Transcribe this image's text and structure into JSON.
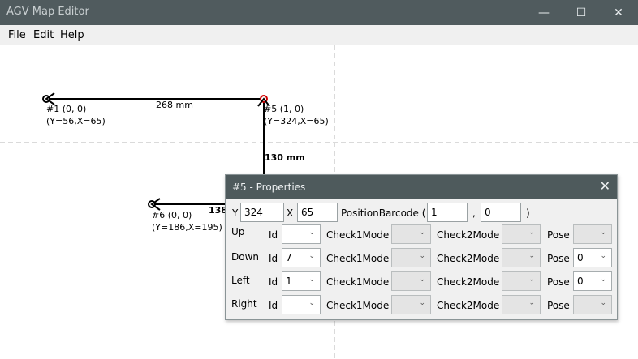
{
  "window": {
    "title": "AGV Map Editor",
    "minimize": "—",
    "maximize": "☐",
    "close": "✕"
  },
  "menu": {
    "file": "File",
    "edit": "Edit",
    "help": "Help"
  },
  "map": {
    "nodes": [
      {
        "id": "#1 (0, 0)",
        "coords": "(Y=56,X=65)"
      },
      {
        "id": "#5 (1, 0)",
        "coords": "(Y=324,X=65)"
      },
      {
        "id": "#6 (0, 0)",
        "coords": "(Y=186,X=195)"
      }
    ],
    "edges": [
      "268 mm",
      "130 mm",
      "138"
    ]
  },
  "dialog": {
    "title": "#5 - Properties",
    "close": "✕",
    "y_label": "Y",
    "y_value": "324",
    "x_label": "X",
    "x_value": "65",
    "barcode_label": "PositionBarcode (",
    "barcode1": "1",
    "comma": ",",
    "barcode2": "0",
    "paren": ")",
    "id_label": "Id",
    "check1_label": "Check1Mode",
    "check2_label": "Check2Mode",
    "pose_label": "Pose",
    "rows": [
      {
        "direction": "Up",
        "id": "",
        "pose": ""
      },
      {
        "direction": "Down",
        "id": "7",
        "pose": "0"
      },
      {
        "direction": "Left",
        "id": "1",
        "pose": "0"
      },
      {
        "direction": "Right",
        "id": "",
        "pose": ""
      }
    ]
  }
}
